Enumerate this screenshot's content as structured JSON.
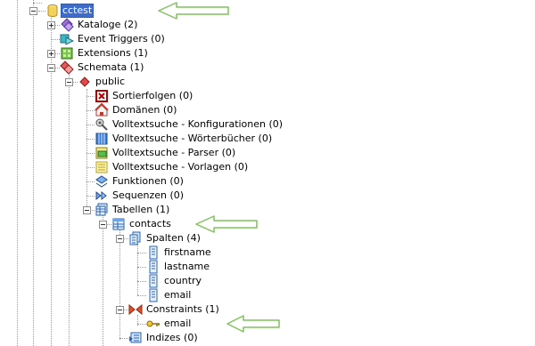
{
  "tree": {
    "root": {
      "label": "cctest"
    },
    "db_children": [
      {
        "label": "Kataloge  (2)",
        "icon": "catalog-icon"
      },
      {
        "label": "Event Triggers (0)",
        "icon": "event-trigger-icon"
      },
      {
        "label": "Extensions  (1)",
        "icon": "extension-icon"
      },
      {
        "label": "Schemata (1)",
        "icon": "schemata-icon"
      }
    ],
    "schema": {
      "label": "public"
    },
    "schema_children": [
      {
        "label": "Sortierfolgen (0)",
        "icon": "collation-icon"
      },
      {
        "label": "Domänen (0)",
        "icon": "domain-icon"
      },
      {
        "label": "Volltextsuche - Konfigurationen (0)",
        "icon": "fts-config-icon"
      },
      {
        "label": "Volltextsuche - Wörterbücher  (0)",
        "icon": "fts-dictionary-icon"
      },
      {
        "label": "Volltextsuche - Parser (0)",
        "icon": "fts-parser-icon"
      },
      {
        "label": "Volltextsuche - Vorlagen (0)",
        "icon": "fts-template-icon"
      },
      {
        "label": "Funktionen (0)",
        "icon": "function-icon"
      },
      {
        "label": "Sequenzen (0)",
        "icon": "sequence-icon"
      },
      {
        "label": "Tabellen (1)",
        "icon": "tables-icon"
      }
    ],
    "table": {
      "label": "contacts"
    },
    "columns_group": {
      "label": "Spalten (4)"
    },
    "columns": [
      "firstname",
      "lastname",
      "country",
      "email"
    ],
    "constraints_group": {
      "label": "Constraints (1)"
    },
    "constraint": {
      "label": "email"
    },
    "indexes_group": {
      "label": "Indizes (0)"
    }
  },
  "colors": {
    "selection": "#3d6ccc",
    "annotation_arrow": "#7fc45a"
  }
}
